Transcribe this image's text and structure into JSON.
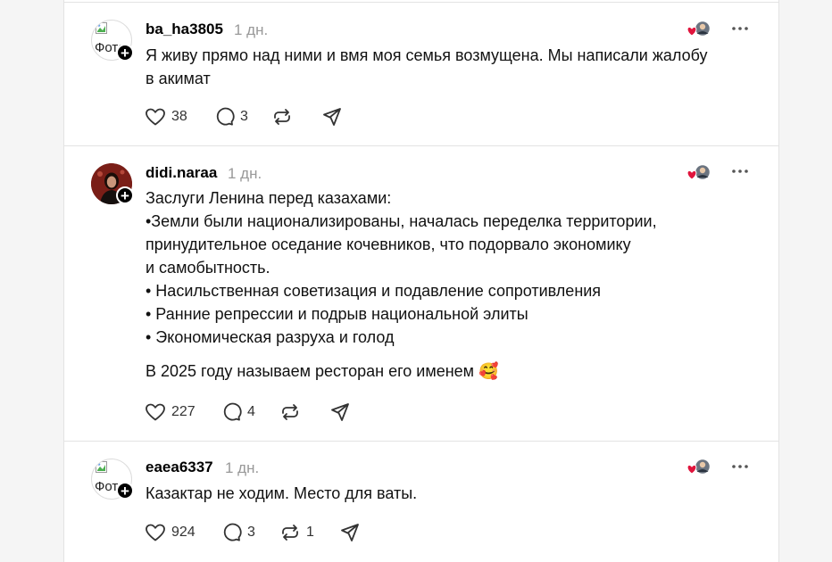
{
  "colors": {
    "background": "#f5f5f5",
    "card": "#ffffff",
    "divider": "#e3e3e3",
    "muted": "#999999",
    "heart": "#e0143c"
  },
  "posts": [
    {
      "username": "ba_ha3805",
      "time": "1 дн.",
      "avatar_alt": "Фото",
      "avatar_type": "broken-image",
      "lines": [
        "Я живу прямо над ними и вмя моя семья возмущена. Мы написали жалобу",
        "в акимат"
      ],
      "likes": "38",
      "replies": "3",
      "reposts": "",
      "icons": [
        "heart-icon",
        "comment-icon",
        "repost-icon",
        "share-icon"
      ]
    },
    {
      "username": "didi.naraa",
      "time": "1 дн.",
      "avatar_type": "photo",
      "lines": [
        "Заслуги Ленина перед казахами:",
        "•Земли были национализированы, началась переделка территории,",
        "принудительное оседание кочевников, что подорвало экономику",
        "и самобытность.",
        "• Насильственная советизация и подавление сопротивления",
        "• Ранние репрессии и подрыв национальной элиты",
        "• Экономическая разруха и голод"
      ],
      "extra_line": "В 2025 году называем ресторан его именем 🥰",
      "likes": "227",
      "replies": "4",
      "reposts": ""
    },
    {
      "username": "eaea6337",
      "time": "1 дн.",
      "avatar_alt": "Фото",
      "avatar_type": "broken-image",
      "lines": [
        "Казактар не ходим. Место для ваты."
      ],
      "likes": "924",
      "replies": "3",
      "reposts": "1"
    }
  ]
}
